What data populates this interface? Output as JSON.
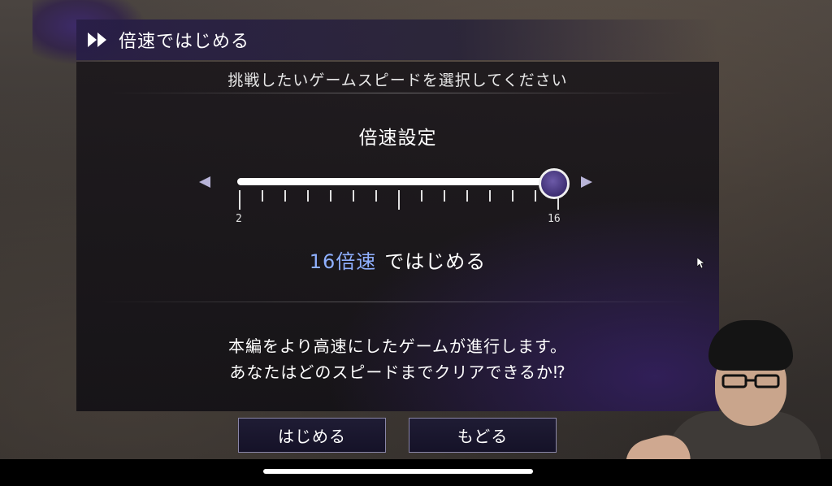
{
  "header": {
    "title": "倍速ではじめる",
    "icon": "fast-forward-icon"
  },
  "panel": {
    "instruction": "挑戦したいゲームスピードを選択してください",
    "setting_label": "倍速設定",
    "slider": {
      "min_label": "2",
      "max_label": "16",
      "min": 2,
      "max": 16,
      "value": 16,
      "tick_count": 15
    },
    "speed_value_text": "16倍速",
    "speed_suffix_text": "ではじめる",
    "description_line1": "本編をより高速にしたゲームが進行します。",
    "description_line2": "あなたはどのスピードまでクリアできるか⁉"
  },
  "buttons": {
    "start_label": "はじめる",
    "back_label": "もどる"
  },
  "colors": {
    "accent_blue": "#8fb0ff",
    "thumb_purple": "#4b3a8a",
    "header_purple": "#2a1f4a"
  }
}
